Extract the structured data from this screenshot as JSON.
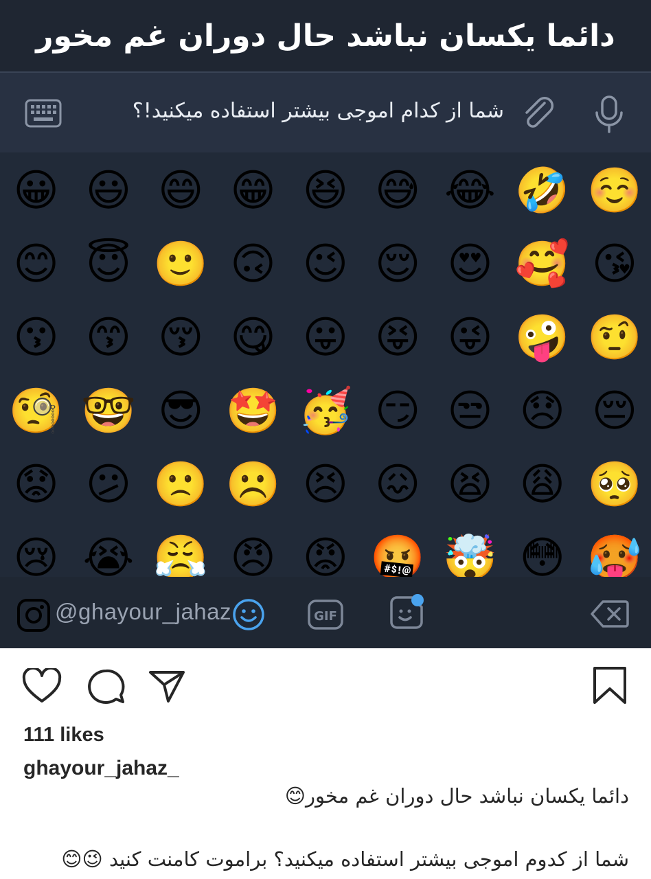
{
  "banner": {
    "title": "دائما یکسان نباشد حال دوران غم مخور"
  },
  "composer": {
    "message": "شما از کدام اموجی بیشتر استفاده میکنید!؟"
  },
  "emoji_grid": [
    "😀",
    "😃",
    "😄",
    "😁",
    "😆",
    "😅",
    "😂",
    "🤣",
    "☺️",
    "😊",
    "😇",
    "🙂",
    "🙃",
    "😉",
    "😌",
    "😍",
    "🥰",
    "😘",
    "😗",
    "😙",
    "😚",
    "😋",
    "😛",
    "😝",
    "😜",
    "🤪",
    "🤨",
    "🧐",
    "🤓",
    "😎",
    "🤩",
    "🥳",
    "😏",
    "😒",
    "😞",
    "😔",
    "😟",
    "😕",
    "🙁",
    "☹️",
    "😣",
    "😖",
    "😫",
    "😩",
    "🥺",
    "😢",
    "😭",
    "😤",
    "😠",
    "😡",
    "🤬",
    "🤯",
    "😳",
    "🥵"
  ],
  "bottom_bar": {
    "handle": "@ghayour_jahaz",
    "gif_label": "GIF",
    "accent_color": "#4aa3ee"
  },
  "post": {
    "likes": "111 likes",
    "username": "ghayour_jahaz_",
    "caption_line1": "دائما یکسان نباشد حال دوران غم مخور😊",
    "caption_line2": "شما از کدوم اموجی بیشتر استفاده میکنید؟ براموت کامنت کنید 😉😊"
  }
}
